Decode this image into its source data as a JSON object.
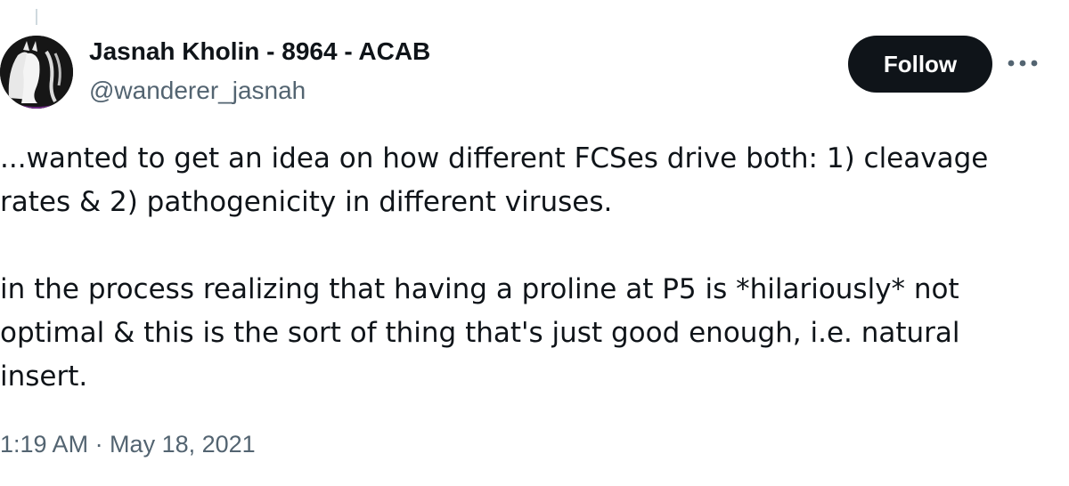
{
  "author": {
    "name": "Jasnah Kholin - 8964 - ACAB",
    "handle": "@wanderer_jasnah"
  },
  "actions": {
    "follow_label": "Follow",
    "more_icon": "more-horizontal-icon"
  },
  "tweet": {
    "paragraph_1": "...wanted to get an idea on how different FCSes drive both: 1) cleavage rates & 2) pathogenicity in different viruses.",
    "paragraph_2": "in the process realizing that having a proline at P5 is *hilariously* not optimal & this is the sort of thing that's just good enough, i.e. natural insert.",
    "timestamp": "1:19 AM · May 18, 2021"
  },
  "colors": {
    "text_primary": "#0f1419",
    "text_secondary": "#536471",
    "follow_button_bg": "#0f1419",
    "follow_button_text": "#ffffff"
  }
}
